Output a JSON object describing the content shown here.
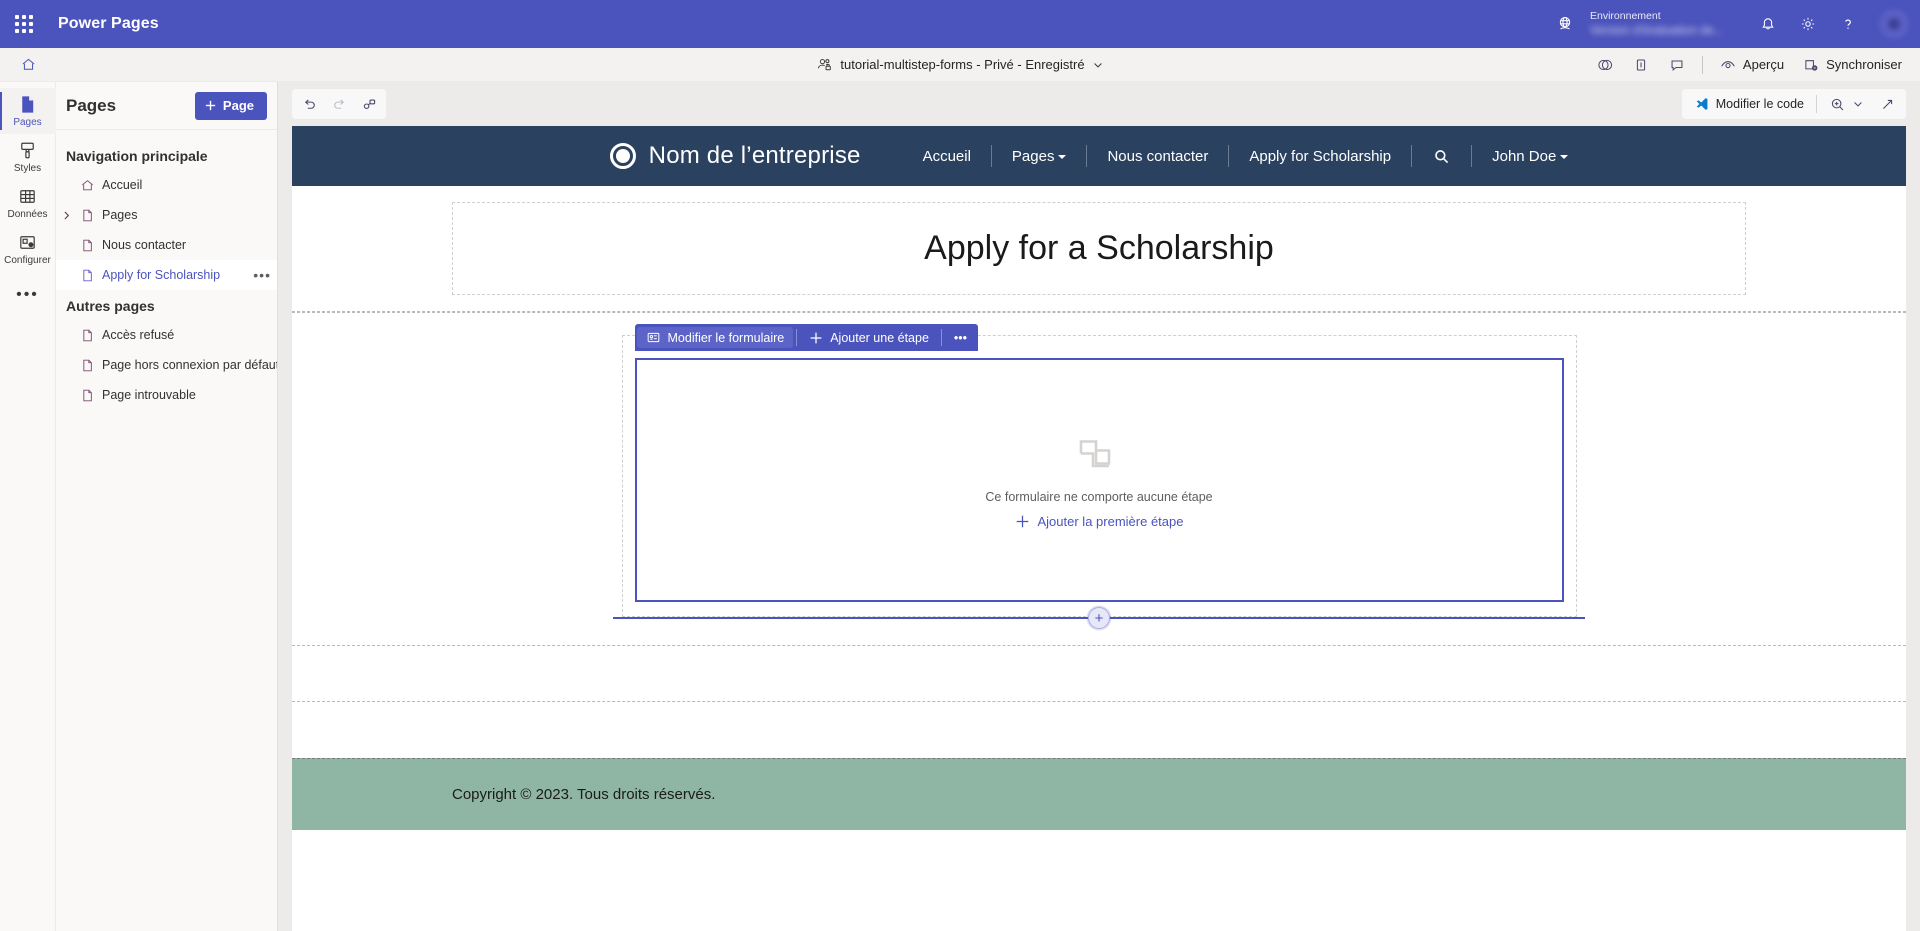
{
  "topbar": {
    "app_title": "Power Pages",
    "waffle_name": "app-launcher",
    "environment_label": "Environnement",
    "environment_value": "Version d'évaluation de...",
    "icons": [
      "globe-icon",
      "bell-icon",
      "gear-icon",
      "help-icon",
      "avatar"
    ]
  },
  "commandbar": {
    "home_icon": "home-icon",
    "site_name": "tutorial-multistep-forms - Privé - Enregistré",
    "chevron": "chevron-down-icon",
    "right_icons": [
      "theme-icon",
      "pane-icon",
      "comment-icon"
    ],
    "preview_label": "Aperçu",
    "sync_label": "Synchroniser"
  },
  "rail": {
    "items": [
      {
        "label": "Pages",
        "icon": "pages-icon"
      },
      {
        "label": "Styles",
        "icon": "brush-icon"
      },
      {
        "label": "Données",
        "icon": "table-icon"
      },
      {
        "label": "Configurer",
        "icon": "configure-icon"
      }
    ],
    "more_label": "•••"
  },
  "panel": {
    "title": "Pages",
    "add_page_label": "Page",
    "groups": [
      {
        "title": "Navigation principale",
        "items": [
          {
            "label": "Accueil",
            "icon": "home-page-icon",
            "expandable": false,
            "selected": false
          },
          {
            "label": "Pages",
            "icon": "page-icon",
            "expandable": true,
            "selected": false
          },
          {
            "label": "Nous contacter",
            "icon": "page-icon",
            "expandable": false,
            "selected": false
          },
          {
            "label": "Apply for Scholarship",
            "icon": "page-icon",
            "expandable": false,
            "selected": true,
            "more": "•••"
          }
        ]
      },
      {
        "title": "Autres pages",
        "items": [
          {
            "label": "Accès refusé",
            "icon": "page-icon",
            "expandable": false,
            "selected": false
          },
          {
            "label": "Page hors connexion par défaut",
            "icon": "page-icon",
            "expandable": false,
            "selected": false
          },
          {
            "label": "Page introuvable",
            "icon": "page-icon",
            "expandable": false,
            "selected": false
          }
        ]
      }
    ]
  },
  "canvas_toolbar": {
    "undo_icon": "undo-icon",
    "redo_icon": "redo-icon",
    "link_icon": "link-icon",
    "edit_code_label": "Modifier le code",
    "zoom_icon": "zoom-in-icon",
    "zoom_chevron": "chevron-down-icon",
    "fullscreen_icon": "expand-icon"
  },
  "site": {
    "header": {
      "logo_icon": "company-logo-icon",
      "company_name": "Nom de l’entreprise",
      "nav": [
        {
          "label": "Accueil",
          "dropdown": false
        },
        {
          "label": "Pages",
          "dropdown": true
        },
        {
          "label": "Nous contacter",
          "dropdown": false
        },
        {
          "label": "Apply for Scholarship",
          "dropdown": false
        },
        {
          "label": "",
          "icon": "search-icon",
          "dropdown": false
        },
        {
          "label": "John Doe",
          "dropdown": true
        }
      ]
    },
    "page_heading": "Apply for a Scholarship",
    "form_toolbar": {
      "edit_form_label": "Modifier le formulaire",
      "edit_form_icon": "form-icon",
      "add_step_label": "Ajouter une étape",
      "add_step_icon": "plus-icon",
      "overflow_label": "•••"
    },
    "form_empty": {
      "glyph": "empty-steps-icon",
      "message": "Ce formulaire ne comporte aucune étape",
      "add_label": "Ajouter la première étape",
      "add_icon": "plus-icon"
    },
    "add_section_icon": "plus-circle-icon",
    "footer_text": "Copyright © 2023. Tous droits réservés."
  },
  "colors": {
    "brand_purple": "#4b53bc",
    "site_header_navy": "#2b4160",
    "footer_green": "#8fb5a4",
    "panel_bg": "#faf9f8",
    "canvas_bg": "#edebe9"
  }
}
